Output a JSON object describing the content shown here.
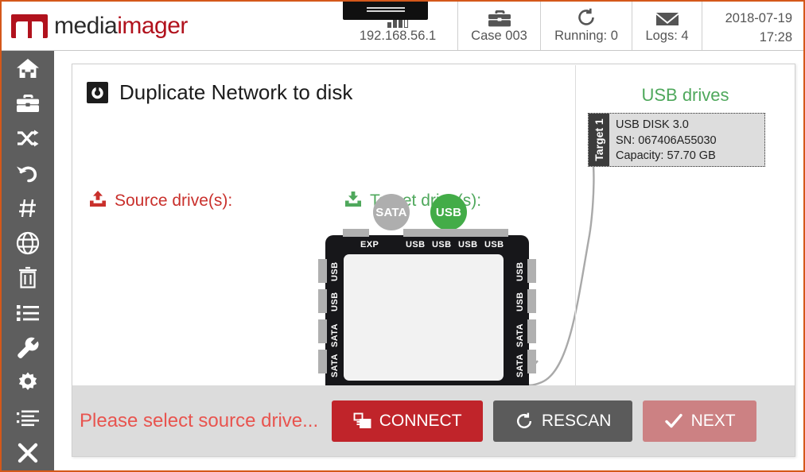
{
  "topbar": {
    "logo": {
      "dark": "media",
      "red": "imager",
      "icon": "mediaimager-logo-mark"
    },
    "status": [
      {
        "id": "network",
        "icon": "signal-bars-icon",
        "label": "192.168.56.1"
      },
      {
        "id": "case",
        "icon": "briefcase-icon",
        "label": "Case 003"
      },
      {
        "id": "running",
        "icon": "refresh-icon",
        "label": "Running: 0"
      },
      {
        "id": "logs",
        "icon": "envelope-icon",
        "label": "Logs: 4"
      }
    ],
    "datetime": {
      "date": "2018-07-19",
      "time": "17:28"
    }
  },
  "sidebar": {
    "items": [
      {
        "icon": "home-icon",
        "name": "sidebar-item-home"
      },
      {
        "icon": "briefcase-icon",
        "name": "sidebar-item-cases"
      },
      {
        "icon": "shuffle-icon",
        "name": "sidebar-item-duplicate"
      },
      {
        "icon": "undo-icon",
        "name": "sidebar-item-restore"
      },
      {
        "icon": "hash-icon",
        "name": "sidebar-item-hash"
      },
      {
        "icon": "globe-icon",
        "name": "sidebar-item-network"
      },
      {
        "icon": "trash-icon",
        "name": "sidebar-item-wipe"
      },
      {
        "icon": "list-icon",
        "name": "sidebar-item-logs"
      },
      {
        "icon": "wrench-icon",
        "name": "sidebar-item-tools"
      },
      {
        "icon": "gear-icon",
        "name": "sidebar-item-settings"
      },
      {
        "icon": "tasks-icon",
        "name": "sidebar-item-tasks"
      },
      {
        "icon": "close-icon",
        "name": "sidebar-item-exit"
      }
    ]
  },
  "page": {
    "title": "Duplicate Network to disk",
    "title_icon": "power-clone-icon",
    "source_label": "Source drive(s):",
    "source_icon": "upload-icon",
    "target_label": "Target drive(s):",
    "target_icon": "download-icon"
  },
  "diagram": {
    "connection_buttons": [
      {
        "label": "SATA",
        "state": "inactive",
        "color": "#aeaeae"
      },
      {
        "label": "USB",
        "state": "active",
        "color": "#43ac48"
      }
    ],
    "device": {
      "top_ports": [
        "EXP",
        "USB",
        "USB",
        "USB",
        "USB"
      ],
      "left_ports": [
        "USB",
        "USB",
        "SATA",
        "SATA"
      ],
      "right_ports": [
        "USB",
        "USB",
        "SATA",
        "SATA"
      ]
    }
  },
  "usb_panel": {
    "title": "USB drives",
    "drives": [
      {
        "tab": "Target 1",
        "name": "USB DISK 3.0",
        "serial": "SN: 067406A55030",
        "capacity": "Capacity: 57.70 GB"
      }
    ]
  },
  "actionbar": {
    "status_message": "Please select source drive...",
    "buttons": [
      {
        "id": "connect",
        "label": "CONNECT",
        "icon": "clone-icon",
        "color": "#c0242a",
        "enabled": true
      },
      {
        "id": "rescan",
        "label": "RESCAN",
        "icon": "refresh-icon",
        "color": "#5b5b5b",
        "enabled": true
      },
      {
        "id": "next",
        "label": "NEXT",
        "icon": "check-icon",
        "color": "#cc8183",
        "enabled": false
      }
    ]
  },
  "colors": {
    "brand_orange": "#d4581a",
    "brand_red": "#b1121d",
    "source_red": "#c9302c",
    "target_green": "#4fa85c",
    "sidebar_grey": "#5e5e5e"
  }
}
